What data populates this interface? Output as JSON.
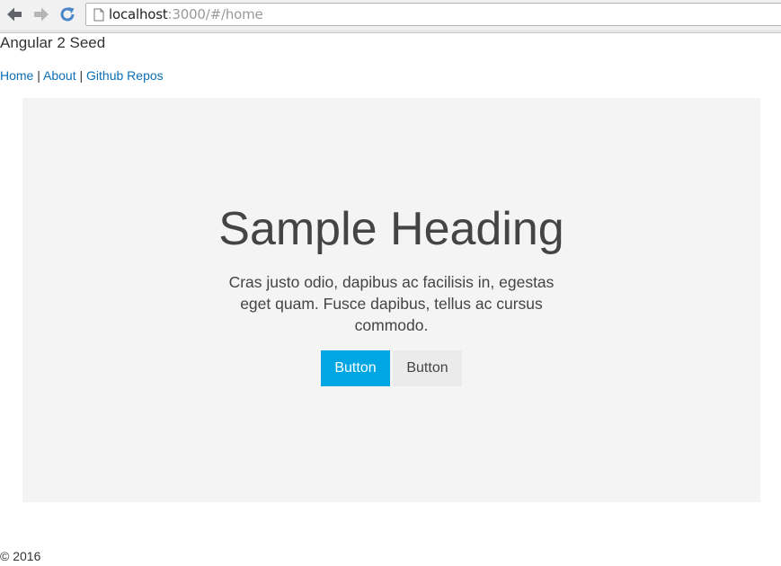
{
  "browser": {
    "url_host": "localhost",
    "url_rest": ":3000/#/home"
  },
  "site": {
    "title": "Angular 2 Seed",
    "nav": [
      {
        "label": "Home"
      },
      {
        "label": "About"
      },
      {
        "label": "Github Repos"
      }
    ],
    "nav_separator": "|"
  },
  "hero": {
    "heading": "Sample Heading",
    "text": "Cras justo odio, dapibus ac facilisis in, egestas eget quam. Fusce dapibus, tellus ac cursus commodo.",
    "primary_button": "Button",
    "secondary_button": "Button"
  },
  "footer": {
    "text": "© 2016"
  },
  "icons": {
    "back": "arrow-left-icon",
    "forward": "arrow-right-icon",
    "reload": "reload-icon",
    "page": "page-icon"
  },
  "colors": {
    "link": "#0a6fb5",
    "primary_button": "#00a6e4",
    "hero_background": "#f4f4f4"
  }
}
